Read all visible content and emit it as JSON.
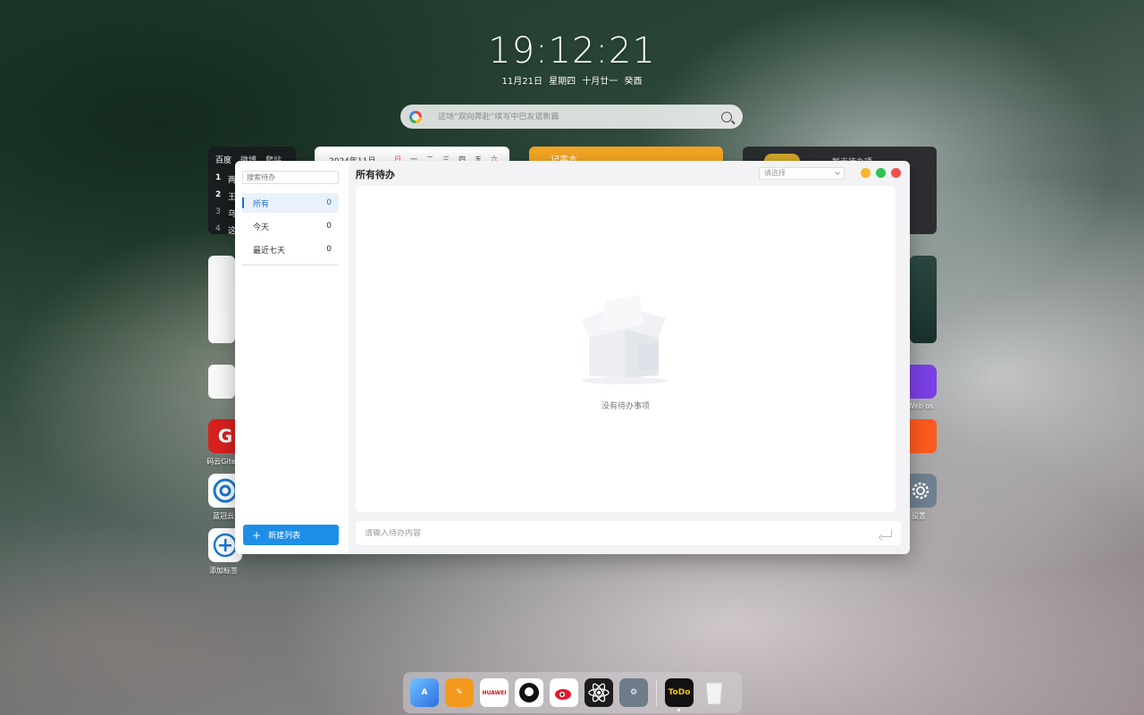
{
  "clock": {
    "time": "19:12:21",
    "date": "11月21日  星期四  十月廿一  癸酉"
  },
  "search": {
    "placeholder": "这场“双向奔赴”续写中巴友谊新篇"
  },
  "widgets": {
    "hot": {
      "tabs": [
        "百度",
        "微博",
        "爬站"
      ],
      "rows": [
        {
          "n": "1",
          "t": "两"
        },
        {
          "n": "2",
          "t": "王"
        },
        {
          "n": "3",
          "t": "乌"
        },
        {
          "n": "4",
          "t": "这"
        }
      ]
    },
    "calendar": {
      "title": "2024年11月",
      "weekdays": [
        "日",
        "一",
        "二",
        "三",
        "四",
        "五",
        "六"
      ]
    },
    "note": {
      "title": "记事本"
    },
    "music": {
      "title": "暂无待办项"
    },
    "apps_left": [
      {
        "label": "码云Gitee"
      },
      {
        "label": "蓝冠云"
      },
      {
        "label": "添加标签"
      }
    ],
    "apps_right": [
      {
        "label": "Web os"
      },
      {
        "label": "设置"
      }
    ]
  },
  "todo": {
    "search_placeholder": "搜索待办",
    "lists": [
      {
        "label": "所有",
        "count": "0"
      },
      {
        "label": "今天",
        "count": "0"
      },
      {
        "label": "最近七天",
        "count": "0"
      }
    ],
    "new_list_label": "新建列表",
    "title": "所有待办",
    "select_placeholder": "请选择",
    "empty_text": "没有待办事项",
    "input_placeholder": "请输入待办内容"
  },
  "dock": {
    "items": [
      {
        "name": "app-store-icon",
        "color": "#3a7bef"
      },
      {
        "name": "paint-icon",
        "color": "#f39a1e"
      },
      {
        "name": "huawei-icon",
        "label": "HUAWEI",
        "color": "#d7131e"
      },
      {
        "name": "github-icon",
        "color": "#111111"
      },
      {
        "name": "weibo-icon",
        "color": "#ffffff"
      },
      {
        "name": "atom-icon",
        "color": "#1c1c1c"
      },
      {
        "name": "settings-icon",
        "color": "#6f7b89"
      },
      {
        "name": "todo-app-icon",
        "label": "ToDo",
        "color": "#111111"
      },
      {
        "name": "trash-icon",
        "color": "#e8e8e8"
      }
    ]
  }
}
